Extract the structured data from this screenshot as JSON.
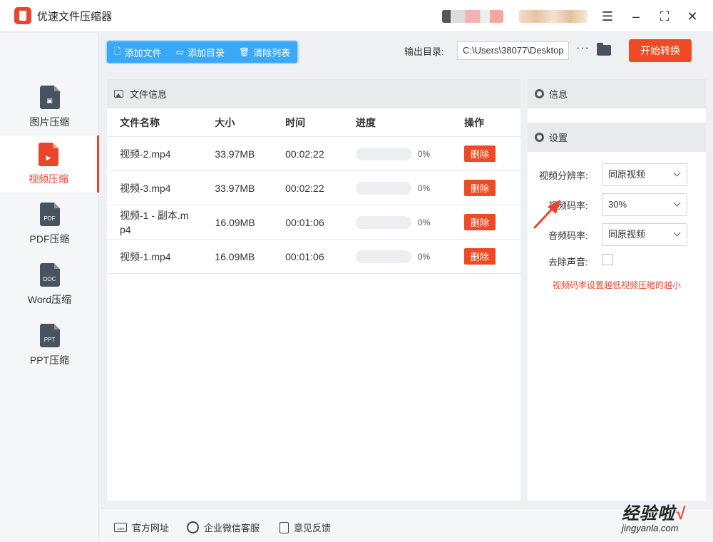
{
  "app": {
    "title": "优速文件压缩器"
  },
  "sidebar": {
    "items": [
      {
        "label": "图片压缩",
        "icon": "image-file-icon",
        "tag": "",
        "active": false
      },
      {
        "label": "视频压缩",
        "icon": "video-file-icon",
        "tag": "",
        "active": true
      },
      {
        "label": "PDF压缩",
        "icon": "pdf-file-icon",
        "tag": "PDF",
        "active": false
      },
      {
        "label": "Word压缩",
        "icon": "doc-file-icon",
        "tag": "DOC",
        "active": false
      },
      {
        "label": "PPT压缩",
        "icon": "ppt-file-icon",
        "tag": "PPT",
        "active": false
      }
    ]
  },
  "toolbar": {
    "add_file": "添加文件",
    "add_folder": "添加目录",
    "clear_list": "清除列表",
    "output_label": "输出目录:",
    "output_path": "C:\\Users\\38077\\Desktop",
    "more": "···",
    "start": "开始转换"
  },
  "file_panel": {
    "title": "文件信息",
    "columns": [
      "文件名称",
      "大小",
      "时间",
      "进度",
      "操作"
    ],
    "rows": [
      {
        "name": "视频-2.mp4",
        "size": "33.97MB",
        "time": "00:02:22",
        "progress": 0,
        "progress_text": "0%",
        "action": "删除"
      },
      {
        "name": "视频-3.mp4",
        "size": "33.97MB",
        "time": "00:02:22",
        "progress": 0,
        "progress_text": "0%",
        "action": "删除"
      },
      {
        "name": "视频-1 - 副本.mp4",
        "size": "16.09MB",
        "time": "00:01:06",
        "progress": 0,
        "progress_text": "0%",
        "action": "删除"
      },
      {
        "name": "视频-1.mp4",
        "size": "16.09MB",
        "time": "00:01:06",
        "progress": 0,
        "progress_text": "0%",
        "action": "删除"
      }
    ]
  },
  "info_panel": {
    "title": "信息"
  },
  "settings": {
    "title": "设置",
    "resolution_label": "视频分辨率:",
    "resolution_value": "同原视频",
    "bitrate_label": "视频码率:",
    "bitrate_value": "30%",
    "audio_label": "音频码率:",
    "audio_value": "同原视频",
    "mute_label": "去除声音:",
    "mute_checked": false,
    "hint": "视频码率设置越低视频压缩的越小"
  },
  "footer": {
    "website": "官方网址",
    "wechat": "企业微信客服",
    "feedback": "意见反馈",
    "website_icon_text": ".com"
  },
  "watermark": {
    "main": "经验啦",
    "sub": "jingyanla.com"
  },
  "colors": {
    "accent": "#e8452c",
    "primary": "#3ba8f5",
    "start_button": "#f04a25"
  }
}
